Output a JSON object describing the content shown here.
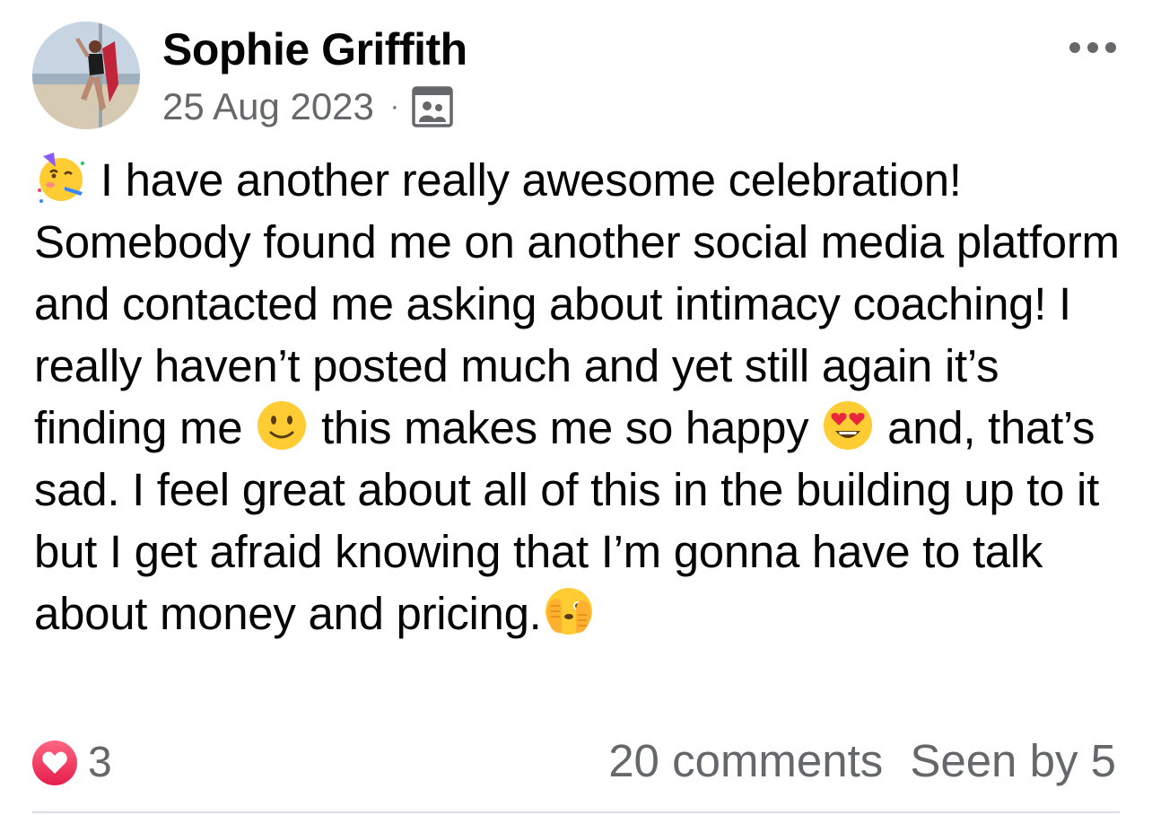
{
  "post": {
    "author": "Sophie Griffith",
    "date": "25 Aug 2023",
    "separator": "·",
    "audience_icon": "group-audience-icon",
    "menu_icon": "more-options-icon",
    "body_segments": [
      "I have another really awesome celebration! Somebody found me on another social media platform and contacted me asking about intimacy coaching! I really haven’t posted much and yet still again it’s finding me",
      "this makes me so happy",
      "and, that’s sad. I feel great about all of this in the building up to it but I get afraid knowing that I’m gonna have to talk about money and pricing."
    ],
    "emojis": [
      "partying-face-emoji",
      "slightly-smiling-face-emoji",
      "heart-eyes-emoji",
      "face-with-peeking-eye-emoji"
    ]
  },
  "footer": {
    "reaction_icon": "heart-reaction-icon",
    "reaction_count": "3",
    "comments": "20 comments",
    "seen_by": "Seen by 5"
  },
  "colors": {
    "text_primary": "#050505",
    "text_secondary": "#65676b",
    "heart": "#f0284a",
    "divider": "#dadde1"
  }
}
